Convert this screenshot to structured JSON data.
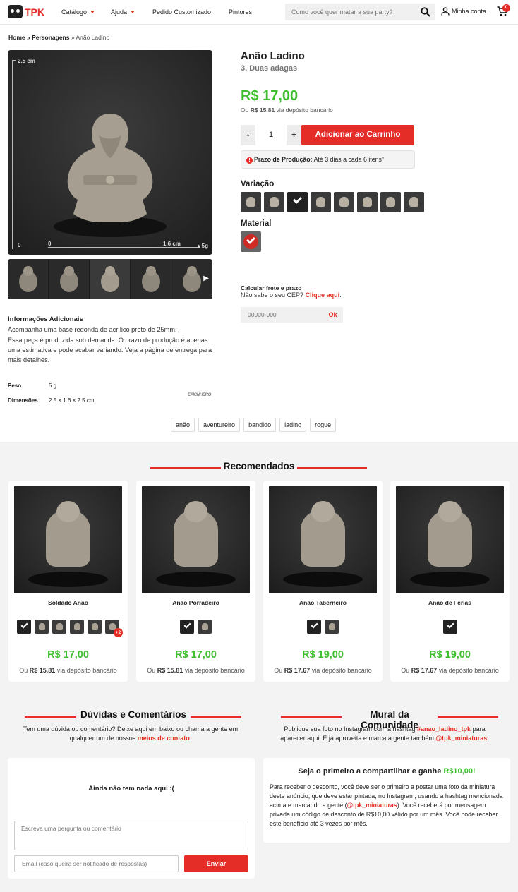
{
  "header": {
    "logo_text": "TPK",
    "nav": [
      {
        "label": "Catálogo",
        "dropdown": true
      },
      {
        "label": "Ajuda",
        "dropdown": true
      },
      {
        "label": "Pedido Customizado",
        "dropdown": false
      },
      {
        "label": "Pintores",
        "dropdown": false
      }
    ],
    "search_placeholder": "Como você quer matar a sua party?",
    "account_label": "Minha conta",
    "cart_count": "0"
  },
  "breadcrumb": {
    "home": "Home",
    "sep1": " » ",
    "category": "Personagens",
    "sep2": " » ",
    "current": "Anão Ladino"
  },
  "gallery": {
    "ruler_top": "2.5 cm",
    "ruler_zero": "0",
    "ruler_h_zero": "0",
    "ruler_h_end": "1.6 cm",
    "weight_badge": "5g",
    "thumb_count": 5
  },
  "product": {
    "title": "Anão Ladino",
    "subtitle": "3. Duas adagas",
    "price": "R$ 17,00",
    "price_sub_prefix": "Ou ",
    "price_sub_value": "R$ 15.81",
    "price_sub_suffix": " via depósito bancário",
    "qty_minus": "-",
    "qty_value": "1",
    "qty_plus": "+",
    "add_to_cart": "Adicionar ao Carrinho",
    "prazo_icon": "!",
    "prazo_label": "Prazo de Produção:",
    "prazo_text": " Até 3 dias a cada 6 itens*",
    "variation_label": "Variação",
    "variation_count": 8,
    "variation_selected": 2,
    "material_label": "Material",
    "frete_title": "Calcular frete e prazo",
    "frete_sub": "Não sabe o seu CEP? ",
    "frete_link": "Clique aqui",
    "frete_dot": ".",
    "cep_placeholder": "00000-000",
    "ok_label": "Ok"
  },
  "info": {
    "title": "Informações Adicionais",
    "line1": "Acompanha uma base redonda de acrílico preto de 25mm.",
    "line2": "Essa peça é produzida sob demanda. O prazo de produção é apenas uma estimativa e pode acabar variando. Veja a página de entrega para mais detalhes.",
    "peso_label": "Peso",
    "peso_value": "5 g",
    "dim_label": "Dimensões",
    "dim_value": "2.5 × 1.6 × 2.5 cm",
    "brand": "EPICNHERO"
  },
  "tags": [
    "anão",
    "aventureiro",
    "bandido",
    "ladino",
    "rogue"
  ],
  "recommended": {
    "title": "Recomendados",
    "items": [
      {
        "name": "Soldado Anão",
        "price": "R$ 17,00",
        "sub_value": "R$ 15.81",
        "swatches": 6,
        "more": "+2"
      },
      {
        "name": "Anão Porradeiro",
        "price": "R$ 17,00",
        "sub_value": "R$ 15.81",
        "swatches": 2,
        "more": ""
      },
      {
        "name": "Anão Taberneiro",
        "price": "R$ 19,00",
        "sub_value": "R$ 17.67",
        "swatches": 2,
        "more": ""
      },
      {
        "name": "Anão de Férias",
        "price": "R$ 19,00",
        "sub_value": "R$ 17.67",
        "swatches": 1,
        "more": ""
      }
    ],
    "sub_prefix": "Ou ",
    "sub_suffix": " via depósito bancário"
  },
  "comments": {
    "title": "Dúvidas e Comentários",
    "desc_1": "Tem uma dúvida ou comentário? Deixe aqui em baixo ou chama a gente em qualquer um de nossos ",
    "desc_link": "meios de contato",
    "desc_2": ".",
    "empty": "Ainda não tem nada aqui :(",
    "textarea_placeholder": "Escreva uma pergunta ou comentário",
    "email_placeholder": "Email (caso queira ser notificado de respostas)",
    "send": "Enviar"
  },
  "community": {
    "title": "Mural da Comunidade",
    "desc_1": "Publique sua foto no Instagram com a hashtag ",
    "hashtag": "#anao_ladino_tpk",
    "desc_2": " para aparecer aqui! E já aproveita e marca a gente também ",
    "handle": "@tpk_miniaturas",
    "desc_3": "!",
    "share_title": "Seja o primeiro a compartilhar e ganhe ",
    "share_value": "R$10,00!",
    "share_text_1": "Para receber o desconto, você deve ser o primeiro a postar uma foto da miniatura deste anúncio, que deve estar pintada, no Instagram, usando a hashtag mencionada acima e marcando a gente (",
    "share_handle": "@tpk_miniaturas",
    "share_text_2": "). Você receberá por mensagem privada um código de desconto de R$10,00 válido por um mês. Você pode receber este benefício até 3 vezes por mês."
  },
  "colors": {
    "accent_red": "#e52d27",
    "price_green": "#3fbf2f"
  }
}
